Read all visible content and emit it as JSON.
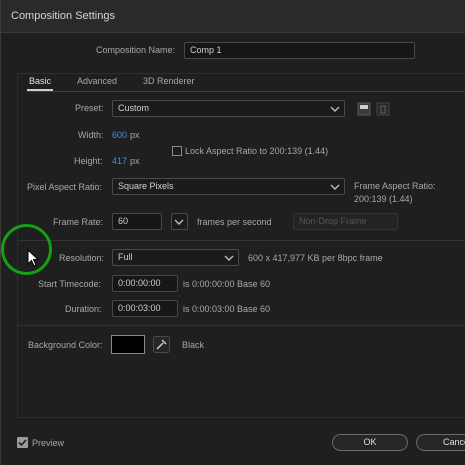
{
  "window": {
    "title": "Composition Settings"
  },
  "comp_name": {
    "label": "Composition Name:",
    "value": "Comp 1"
  },
  "tabs": [
    {
      "label": "Basic"
    },
    {
      "label": "Advanced"
    },
    {
      "label": "3D Renderer"
    }
  ],
  "preset": {
    "label": "Preset:",
    "value": "Custom"
  },
  "width": {
    "label": "Width:",
    "value": "600",
    "unit": "px"
  },
  "height": {
    "label": "Height:",
    "value": "417",
    "unit": "px"
  },
  "lock_aspect": {
    "label": "Lock Aspect Ratio to 200:139 (1.44)",
    "checked": false
  },
  "pixel_aspect": {
    "label": "Pixel Aspect Ratio:",
    "value": "Square Pixels"
  },
  "frame_aspect": {
    "line1": "Frame Aspect Ratio:",
    "line2": "200:139 (1.44)"
  },
  "frame_rate": {
    "label": "Frame Rate:",
    "value": "60",
    "unit_label": "frames per second",
    "drop_frame": "Non-Drop Frame"
  },
  "resolution": {
    "label": "Resolution:",
    "value": "Full",
    "info": "600 x 417,977 KB per 8bpc frame"
  },
  "start_timecode": {
    "label": "Start Timecode:",
    "value": "0:00:00:00",
    "info": "is 0:00:00:00  Base 60"
  },
  "duration": {
    "label": "Duration:",
    "value": "0:00:03:00",
    "info": "is 0:00:03:00  Base 60"
  },
  "background_color": {
    "label": "Background Color:",
    "color": "#000000",
    "name": "Black"
  },
  "preview": {
    "label": "Preview",
    "checked": true
  },
  "buttons": {
    "ok": "OK",
    "cancel": "Cance"
  },
  "colors": {
    "accent_blue": "#4a8fdc",
    "annotation_green": "#14a014"
  }
}
